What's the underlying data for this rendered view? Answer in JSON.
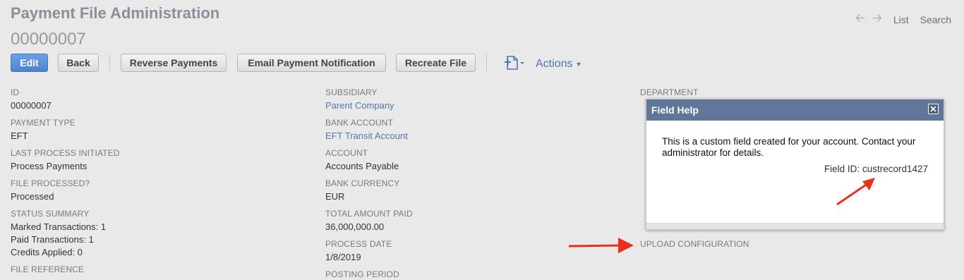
{
  "header": {
    "title": "Payment File Administration",
    "record_id": "00000007",
    "nav": {
      "back_icon": "left-arrow-icon",
      "forward_icon": "right-arrow-icon",
      "list_label": "List",
      "search_label": "Search"
    }
  },
  "toolbar": {
    "edit_label": "Edit",
    "back_label": "Back",
    "reverse_label": "Reverse Payments",
    "email_label": "Email Payment Notification",
    "recreate_label": "Recreate File",
    "new_icon": "new-document-icon",
    "actions_label": "Actions"
  },
  "fields": {
    "col1": [
      {
        "label": "ID",
        "value": "00000007"
      },
      {
        "label": "Payment Type",
        "value": "EFT"
      },
      {
        "label": "Last Process Initiated",
        "value": "Process Payments"
      },
      {
        "label": "File Processed?",
        "value": "Processed"
      },
      {
        "label": "Status Summary",
        "value_lines": [
          "Marked Transactions: 1",
          "Paid Transactions: 1",
          "Credits Applied: 0"
        ]
      },
      {
        "label": "File Reference"
      }
    ],
    "col2": [
      {
        "label": "Subsidiary",
        "value": "Parent Company"
      },
      {
        "label": "Bank Account",
        "value": "EFT Transit Account"
      },
      {
        "label": "Account",
        "value": "Accounts Payable"
      },
      {
        "label": "Bank Currency",
        "value": "EUR"
      },
      {
        "label": "Total Amount Paid",
        "value": "36,000,000.00"
      },
      {
        "label": "Process Date",
        "value": "1/8/2019"
      },
      {
        "label": "Posting Period"
      }
    ],
    "col3": [
      {
        "label": "Department"
      },
      {
        "label": "Upload Configuration"
      }
    ]
  },
  "field_help": {
    "title": "Field Help",
    "close_icon": "close-icon",
    "message": "This is a custom field created for your account. Contact your administrator for details.",
    "field_id": "Field ID: custrecord1427"
  },
  "colors": {
    "annotation_arrow": "#e8301c",
    "popup_header": "#607799",
    "primary_button": "#5a8fd9",
    "link": "#5577aa"
  }
}
